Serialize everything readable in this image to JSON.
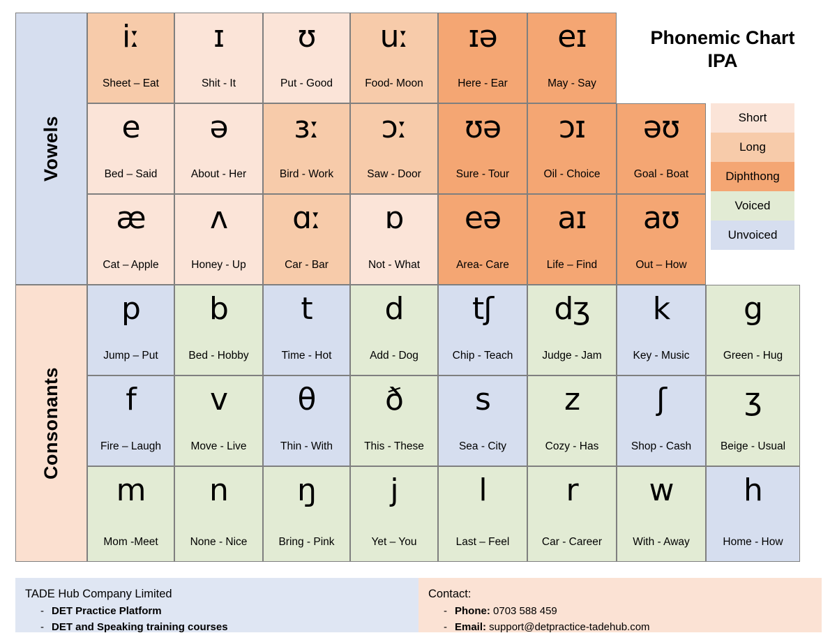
{
  "title": {
    "line1": "Phonemic Chart",
    "line2": "IPA"
  },
  "colors": {
    "short": "#fbe4d8",
    "long": "#f7cbaa",
    "diphthong": "#f4a673",
    "voiced": "#e2ebd4",
    "unvoiced": "#d6deef",
    "vowels_label_bg": "#d6deef",
    "consonants_label_bg": "#fbe0d0",
    "footer_left_bg": "#dfe6f3",
    "footer_right_bg": "#fbe2d4",
    "border": "#7f7f7f"
  },
  "side_labels": {
    "vowels": "Vowels",
    "consonants": "Consonants"
  },
  "legend": {
    "items": [
      {
        "label": "Short",
        "key": "short"
      },
      {
        "label": "Long",
        "key": "long"
      },
      {
        "label": "Diphthong",
        "key": "diphthong"
      },
      {
        "label": "Voiced",
        "key": "voiced"
      },
      {
        "label": "Unvoiced",
        "key": "unvoiced"
      }
    ]
  },
  "vowels": {
    "rows": [
      [
        {
          "symbol": "iː",
          "example": "Sheet – Eat",
          "type": "long"
        },
        {
          "symbol": "ɪ",
          "example": "Shit - It",
          "type": "short"
        },
        {
          "symbol": "ʊ",
          "example": "Put - Good",
          "type": "short"
        },
        {
          "symbol": "uː",
          "example": "Food- Moon",
          "type": "long"
        },
        {
          "symbol": "ɪə",
          "example": "Here - Ear",
          "type": "diphthong"
        },
        {
          "symbol": "eɪ",
          "example": "May - Say",
          "type": "diphthong"
        }
      ],
      [
        {
          "symbol": "e",
          "example": "Bed – Said",
          "type": "short"
        },
        {
          "symbol": "ə",
          "example": "About - Her",
          "type": "short"
        },
        {
          "symbol": "ɜː",
          "example": "Bird - Work",
          "type": "long"
        },
        {
          "symbol": "ɔː",
          "example": "Saw - Door",
          "type": "long"
        },
        {
          "symbol": "ʊə",
          "example": "Sure - Tour",
          "type": "diphthong"
        },
        {
          "symbol": "ɔɪ",
          "example": "Oil - Choice",
          "type": "diphthong"
        },
        {
          "symbol": "əʊ",
          "example": "Goal - Boat",
          "type": "diphthong"
        }
      ],
      [
        {
          "symbol": "æ",
          "example": "Cat – Apple",
          "type": "short"
        },
        {
          "symbol": "ʌ",
          "example": "Honey - Up",
          "type": "short"
        },
        {
          "symbol": "ɑː",
          "example": "Car - Bar",
          "type": "long"
        },
        {
          "symbol": "ɒ",
          "example": "Not - What",
          "type": "short"
        },
        {
          "symbol": "eə",
          "example": "Area- Care",
          "type": "diphthong"
        },
        {
          "symbol": "aɪ",
          "example": "Life – Find",
          "type": "diphthong"
        },
        {
          "symbol": "aʊ",
          "example": "Out – How",
          "type": "diphthong"
        }
      ]
    ]
  },
  "consonants": {
    "rows": [
      [
        {
          "symbol": "p",
          "example": "Jump – Put",
          "type": "unvoiced"
        },
        {
          "symbol": "b",
          "example": "Bed - Hobby",
          "type": "voiced"
        },
        {
          "symbol": "t",
          "example": "Time - Hot",
          "type": "unvoiced"
        },
        {
          "symbol": "d",
          "example": "Add - Dog",
          "type": "voiced"
        },
        {
          "symbol": "tʃ",
          "example": "Chip - Teach",
          "type": "unvoiced"
        },
        {
          "symbol": "dʒ",
          "example": "Judge - Jam",
          "type": "voiced"
        },
        {
          "symbol": "k",
          "example": "Key - Music",
          "type": "unvoiced"
        },
        {
          "symbol": "g",
          "example": "Green - Hug",
          "type": "voiced"
        }
      ],
      [
        {
          "symbol": "f",
          "example": "Fire – Laugh",
          "type": "unvoiced"
        },
        {
          "symbol": "v",
          "example": "Move - Live",
          "type": "voiced"
        },
        {
          "symbol": "θ",
          "example": "Thin - With",
          "type": "unvoiced"
        },
        {
          "symbol": "ð",
          "example": "This - These",
          "type": "voiced"
        },
        {
          "symbol": "s",
          "example": "Sea - City",
          "type": "unvoiced"
        },
        {
          "symbol": "z",
          "example": "Cozy - Has",
          "type": "voiced"
        },
        {
          "symbol": "ʃ",
          "example": "Shop - Cash",
          "type": "unvoiced"
        },
        {
          "symbol": "ʒ",
          "example": "Beige - Usual",
          "type": "voiced"
        }
      ],
      [
        {
          "symbol": "m",
          "example": "Mom -Meet",
          "type": "voiced"
        },
        {
          "symbol": "n",
          "example": "None - Nice",
          "type": "voiced"
        },
        {
          "symbol": "ŋ",
          "example": "Bring - Pink",
          "type": "voiced"
        },
        {
          "symbol": "j",
          "example": "Yet – You",
          "type": "voiced"
        },
        {
          "symbol": "l",
          "example": "Last – Feel",
          "type": "voiced"
        },
        {
          "symbol": "r",
          "example": "Car - Career",
          "type": "voiced"
        },
        {
          "symbol": "w",
          "example": "With - Away",
          "type": "voiced"
        },
        {
          "symbol": "h",
          "example": "Home - How",
          "type": "unvoiced"
        }
      ]
    ]
  },
  "footer": {
    "left": {
      "heading": "TADE Hub Company Limited",
      "items": [
        {
          "dash": "-",
          "bold": "DET Practice Platform",
          "rest": ""
        },
        {
          "dash": "-",
          "bold": "DET and Speaking training courses",
          "rest": ""
        }
      ]
    },
    "right": {
      "heading": "Contact:",
      "items": [
        {
          "dash": "-",
          "bold": "Phone:",
          "rest": " 0703 588 459"
        },
        {
          "dash": "-",
          "bold": "Email:",
          "rest": " support@detpractice-tadehub.com"
        }
      ]
    }
  }
}
